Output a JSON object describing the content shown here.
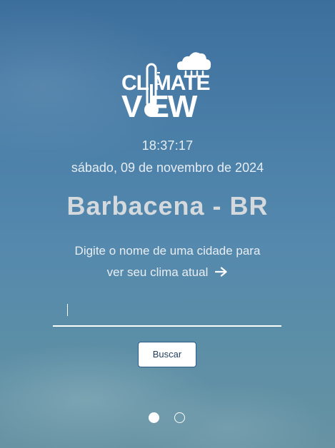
{
  "logo": {
    "line1": "CL MATE",
    "line2": "V EW",
    "icon": "cloud-rain-icon",
    "thermometer": "thermometer-icon"
  },
  "clock": "18:37:17",
  "date": "sábado, 09 de novembro de 2024",
  "city": "Barbacena - BR",
  "prompt": {
    "line1": "Digite o nome de uma cidade para",
    "line2": "ver seu clima atual",
    "icon": "arrow-right-icon"
  },
  "search": {
    "value": "",
    "placeholder": ""
  },
  "button": {
    "label": "Buscar"
  },
  "carousel": {
    "active_index": 0,
    "count": 2
  }
}
